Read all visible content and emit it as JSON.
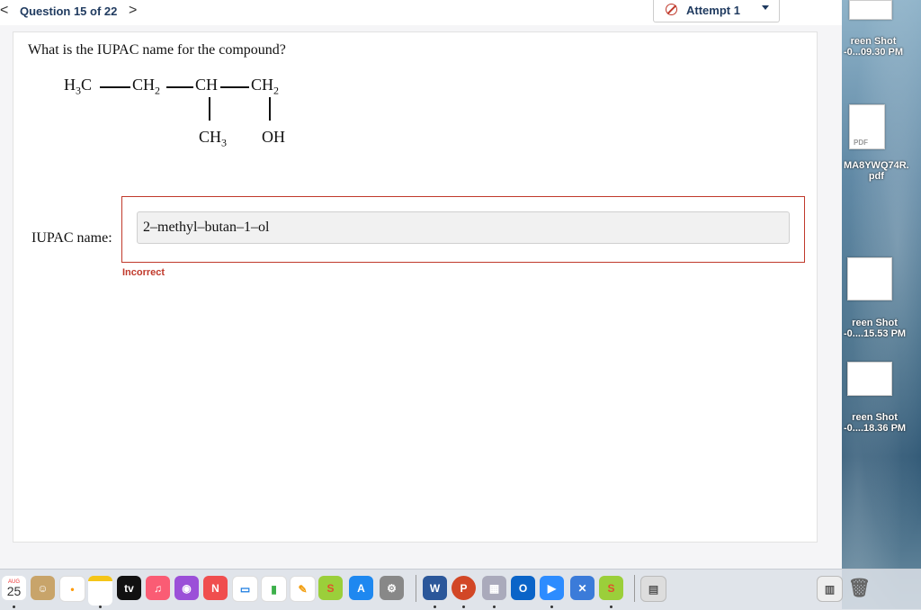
{
  "header": {
    "question_counter": "Question 15 of 22",
    "prev_glyph": "<",
    "next_glyph": ">",
    "attempt_label": "Attempt 1"
  },
  "question": {
    "prompt": "What is the IUPAC name for the compound?",
    "structure": {
      "main_chain": [
        "H",
        "3",
        "C",
        "CH",
        "2",
        "CH",
        "CH",
        "2"
      ],
      "sub1": "CH",
      "sub1_sub": "3",
      "sub2": "OH"
    },
    "answer_label": "IUPAC name:",
    "answer_value": "2–methyl–butan–1–ol",
    "status": "Incorrect"
  },
  "desktop": {
    "files": [
      {
        "line1": "reen Shot",
        "line2": "-0...09.30 PM"
      },
      {
        "line1": "MA8YWQ74R.",
        "line2": "pdf"
      },
      {
        "line1": "reen Shot",
        "line2": "-0....15.53 PM"
      },
      {
        "line1": "reen Shot",
        "line2": "-0....18.36 PM"
      }
    ],
    "pdf_badge": "PDF"
  },
  "dock": {
    "calendar_month": "AUG",
    "calendar_day": "25",
    "tv_label": "tv",
    "word_label": "W",
    "ppt_label": "P",
    "outlook_label": "O",
    "icons": [
      "calendar-icon",
      "contacts-icon",
      "reminders-icon",
      "notes-icon",
      "apple-tv-icon",
      "music-icon",
      "podcasts-icon",
      "news-icon",
      "keynote-icon",
      "numbers-icon",
      "pages-icon",
      "pearson-icon",
      "app-store-icon",
      "system-preferences-icon",
      "word-icon",
      "powerpoint-icon",
      "preview-icon",
      "outlook-icon",
      "zoom-icon",
      "xcode-icon",
      "pearson2-icon",
      "recent-folder-icon",
      "downloads-icon",
      "trash-icon"
    ],
    "colors": {
      "calendar": "#ffffff",
      "contacts": "#c8a46a",
      "music": "#fa5c74",
      "podcasts": "#9b4fd8",
      "news": "#f04e4e",
      "numbers": "#3cb04a",
      "app_store": "#1e88f0",
      "word": "#2b579a",
      "powerpoint": "#d24726",
      "outlook": "#0a64c8",
      "zoom": "#2d8cff",
      "pearson": "#e1502d"
    }
  }
}
